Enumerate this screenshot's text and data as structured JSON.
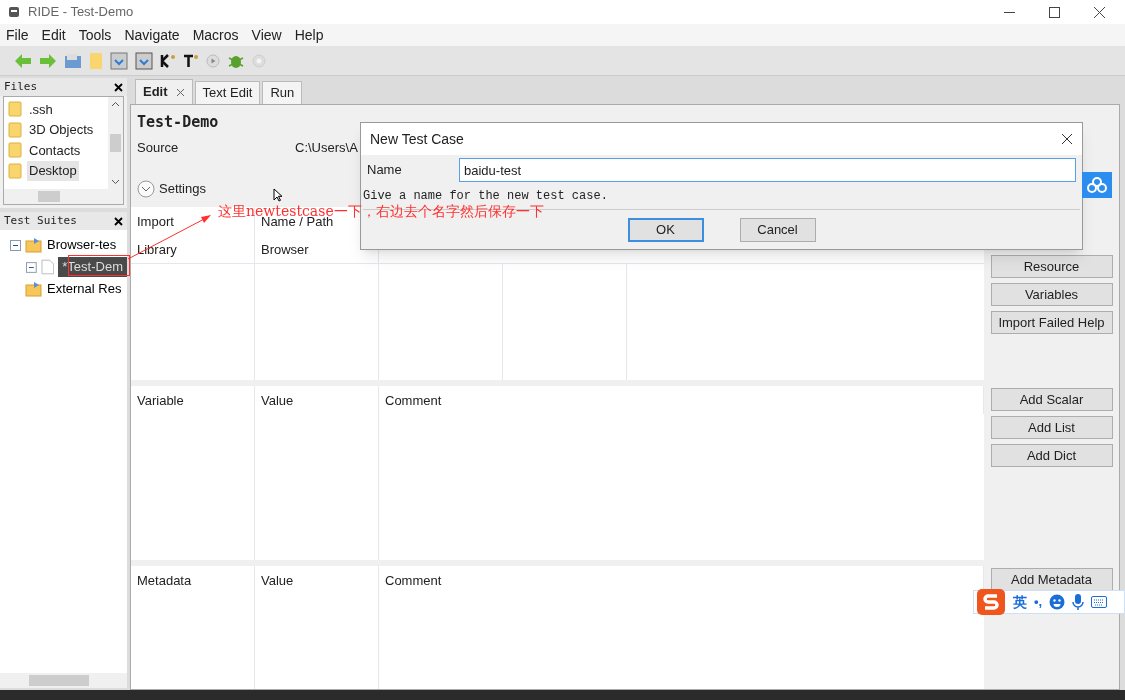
{
  "window": {
    "title": "RIDE - Test-Demo"
  },
  "menu": [
    "File",
    "Edit",
    "Tools",
    "Navigate",
    "Macros",
    "View",
    "Help"
  ],
  "files_panel": {
    "title": "Files",
    "items": [
      {
        "label": ".ssh",
        "selected": false
      },
      {
        "label": "3D Objects",
        "selected": false
      },
      {
        "label": "Contacts",
        "selected": false
      },
      {
        "label": "Desktop",
        "selected": true
      }
    ]
  },
  "suites_panel": {
    "title": "Test Suites",
    "tree": [
      {
        "label": "Browser-tes",
        "expanded": true,
        "selected": false,
        "children": [
          {
            "label": "*Test-Dem",
            "expanded": true,
            "selected": true
          }
        ]
      },
      {
        "label": "External Res",
        "selected": false
      }
    ]
  },
  "tabs": [
    {
      "label": "Edit",
      "selected": true,
      "closable": true
    },
    {
      "label": "Text Edit",
      "selected": false,
      "closable": false
    },
    {
      "label": "Run",
      "selected": false,
      "closable": false
    }
  ],
  "editor": {
    "title": "Test-Demo",
    "source_label": "Source",
    "source_value": "C:\\Users\\A",
    "settings_label": "Settings",
    "imports": {
      "columns": [
        "Import",
        "Name / Path"
      ],
      "rows": [
        [
          "Library",
          "Browser"
        ]
      ]
    },
    "variables": {
      "columns": [
        "Variable",
        "Value",
        "Comment"
      ]
    },
    "metadata": {
      "columns": [
        "Metadata",
        "Value",
        "Comment"
      ]
    },
    "button_groups": [
      [
        "Resource",
        "Variables",
        "Import Failed Help"
      ],
      [
        "Add Scalar",
        "Add List",
        "Add Dict"
      ],
      [
        "Add Metadata"
      ]
    ]
  },
  "dialog": {
    "title": "New Test Case",
    "field_label": "Name",
    "value": "baidu-test",
    "hint": "Give a name for the new test case.",
    "buttons": [
      {
        "label": "OK",
        "default": true
      },
      {
        "label": "Cancel",
        "default": false
      }
    ]
  },
  "annotation": {
    "text": "这里newtestcase一下，右边去个名字然后保存一下"
  },
  "ime": {
    "mode": "英",
    "punct": "•,"
  }
}
